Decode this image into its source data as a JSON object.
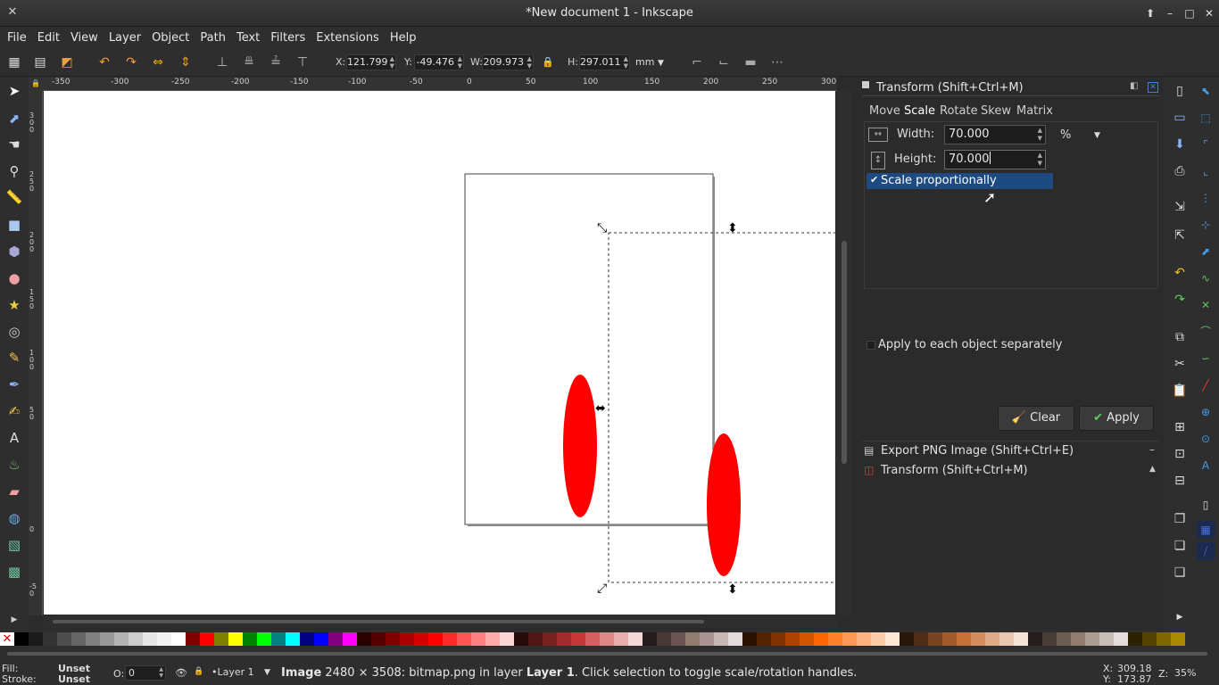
{
  "window": {
    "title": "*New document 1 - Inkscape",
    "min": "–",
    "max": "□",
    "close": "✕",
    "up": "⬆"
  },
  "menu": [
    "File",
    "Edit",
    "View",
    "Layer",
    "Object",
    "Path",
    "Text",
    "Filters",
    "Extensions",
    "Help"
  ],
  "toolctrl": {
    "x_label": "X:",
    "x_value": "121.799",
    "y_label": "Y:",
    "y_value": "-49.476",
    "w_label": "W:",
    "w_value": "209.973",
    "h_label": "H:",
    "h_value": "297.011",
    "unit": "mm"
  },
  "ruler": {
    "h_ticks": [
      "-350",
      "-300",
      "-250",
      "-200",
      "-150",
      "-100",
      "-50",
      "0",
      "50",
      "100",
      "150",
      "200",
      "250",
      "300"
    ],
    "v_ticks": [
      "300",
      "250",
      "200",
      "150",
      "100",
      "50",
      "0",
      "-50"
    ]
  },
  "dialog": {
    "title": "Transform (Shift+Ctrl+M)",
    "tabs": [
      "Move",
      "Scale",
      "Rotate",
      "Skew",
      "Matrix"
    ],
    "active_tab": "Scale",
    "width_label": "Width:",
    "width_value": "70.000",
    "height_label": "Height:",
    "height_value": "70.000",
    "unit": "%",
    "scale_prop_label": "Scale proportionally",
    "apply_each_label": "Apply to each object separately",
    "clear_label": "Clear",
    "apply_label": "Apply"
  },
  "collapsed": [
    {
      "label": "Export PNG Image (Shift+Ctrl+E)",
      "sign": "–"
    },
    {
      "label": "Transform (Shift+Ctrl+M)",
      "sign": "▲"
    }
  ],
  "palette": [
    "#000000",
    "#1a1a1a",
    "#333333",
    "#4d4d4d",
    "#666666",
    "#808080",
    "#999999",
    "#b3b3b3",
    "#cccccc",
    "#e6e6e6",
    "#f2f2f2",
    "#ffffff",
    "#800000",
    "#ff0000",
    "#808000",
    "#ffff00",
    "#008000",
    "#00ff00",
    "#008080",
    "#00ffff",
    "#000080",
    "#0000ff",
    "#800080",
    "#ff00ff",
    "#2b0000",
    "#550000",
    "#800000",
    "#aa0000",
    "#d40000",
    "#ff0000",
    "#ff2a2a",
    "#ff5555",
    "#ff8080",
    "#ffaaaa",
    "#ffd5d5",
    "#280b0b",
    "#501616",
    "#782121",
    "#a02c2c",
    "#c83737",
    "#d35f5f",
    "#de8787",
    "#e9afaf",
    "#f4d7d7",
    "#241c1c",
    "#483737",
    "#6c5353",
    "#917c6f",
    "#ac9393",
    "#c8b7b7",
    "#e3dbdb",
    "#2b1100",
    "#552200",
    "#803300",
    "#aa4400",
    "#d45500",
    "#ff6600",
    "#ff7f2a",
    "#ff9955",
    "#ffb380",
    "#ffccaa",
    "#ffe6d5",
    "#28170b",
    "#502d16",
    "#784421",
    "#a05a2c",
    "#c87137",
    "#d38d5f",
    "#deaa87",
    "#e9c6af",
    "#f4e3d7",
    "#241f1c",
    "#483e37",
    "#6c5d53",
    "#917c6f",
    "#ac9d93",
    "#c8beb7",
    "#e3dedb",
    "#2b2200",
    "#554400",
    "#806600",
    "#aa8800"
  ],
  "status": {
    "fill_label": "Fill:",
    "fill_value": "Unset",
    "stroke_label": "Stroke:",
    "stroke_value": "Unset",
    "opacity_label": "O:",
    "opacity_value": "0",
    "layer": "•Layer 1",
    "msg_bold": "Image",
    "msg_a": " 2480 × 3508: bitmap.png in layer ",
    "msg_layer": "Layer 1",
    "msg_b": ". Click selection to toggle scale/rotation handles.",
    "cx_label": "X:",
    "cx": "309.18",
    "cy_label": "Y:",
    "cy": "173.87",
    "zoom_label": "Z:",
    "zoom": "35%"
  }
}
